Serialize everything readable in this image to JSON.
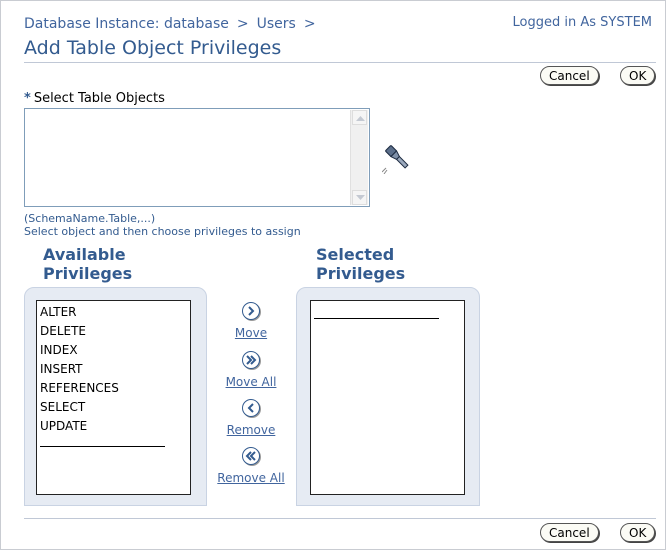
{
  "breadcrumb": {
    "db_instance": "Database Instance: database",
    "separator": ">",
    "users": "Users"
  },
  "logged_in": "Logged in As SYSTEM",
  "page_title": "Add Table Object Privileges",
  "buttons": {
    "cancel": "Cancel",
    "ok": "OK"
  },
  "select_objects": {
    "required_marker": "*",
    "label": "Select Table Objects",
    "value": "",
    "format_hint": "(SchemaName.Table,...)",
    "instruction": "Select object and then choose privileges to assign"
  },
  "available": {
    "heading_line1": "Available",
    "heading_line2": "Privileges",
    "items": [
      "ALTER",
      "DELETE",
      "INDEX",
      "INSERT",
      "REFERENCES",
      "SELECT",
      "UPDATE"
    ]
  },
  "selected": {
    "heading_line1": "Selected",
    "heading_line2": "Privileges",
    "items": []
  },
  "shuttle": {
    "move": "Move",
    "move_all": "Move All",
    "remove": "Remove",
    "remove_all": "Remove All"
  },
  "icons": {
    "search": "flashlight-icon",
    "move": "chevron-right-icon",
    "move_all": "double-chevron-right-icon",
    "remove": "chevron-left-icon",
    "remove_all": "double-chevron-left-icon"
  },
  "colors": {
    "header_text": "#335b8f",
    "link": "#41659e",
    "panel_bg": "#e6ebf3"
  }
}
